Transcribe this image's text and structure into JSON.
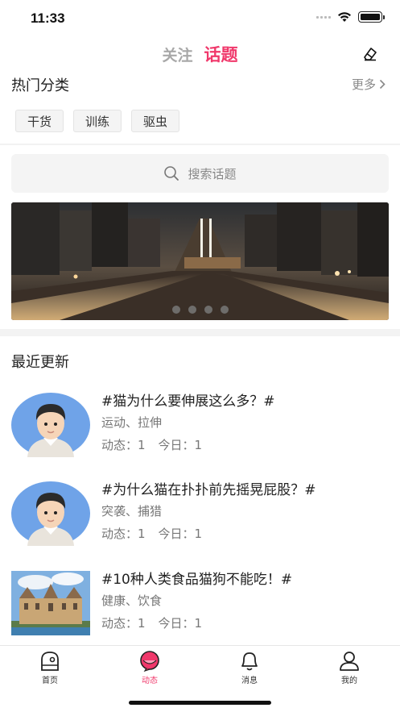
{
  "status": {
    "time": "11:33"
  },
  "nav": {
    "tab_follow": "关注",
    "tab_topic": "话题"
  },
  "hot": {
    "title": "热门分类",
    "more": "更多",
    "chips": [
      "干货",
      "训练",
      "驱虫"
    ]
  },
  "search": {
    "placeholder": "搜索话题"
  },
  "banner": {
    "slide_count": 4
  },
  "recent": {
    "title": "最近更新",
    "items": [
      {
        "title": "#猫为什么要伸展这么多？#",
        "tags": "运动、拉伸",
        "stats_dynamic": "动态：1",
        "stats_today": "今日：1",
        "thumb": "avatar"
      },
      {
        "title": "#为什么猫在扑扑前先摇晃屁股？#",
        "tags": "突袭、捕猎",
        "stats_dynamic": "动态：1",
        "stats_today": "今日：1",
        "thumb": "avatar"
      },
      {
        "title": "#10种人类食品猫狗不能吃！#",
        "tags": "健康、饮食",
        "stats_dynamic": "动态：1",
        "stats_today": "今日：1",
        "thumb": "castle"
      }
    ]
  },
  "tabbar": {
    "items": [
      "首页",
      "动态",
      "消息",
      "我的"
    ],
    "active_index": 1
  },
  "colors": {
    "accent": "#f0386b",
    "muted": "#a8a8a8"
  }
}
